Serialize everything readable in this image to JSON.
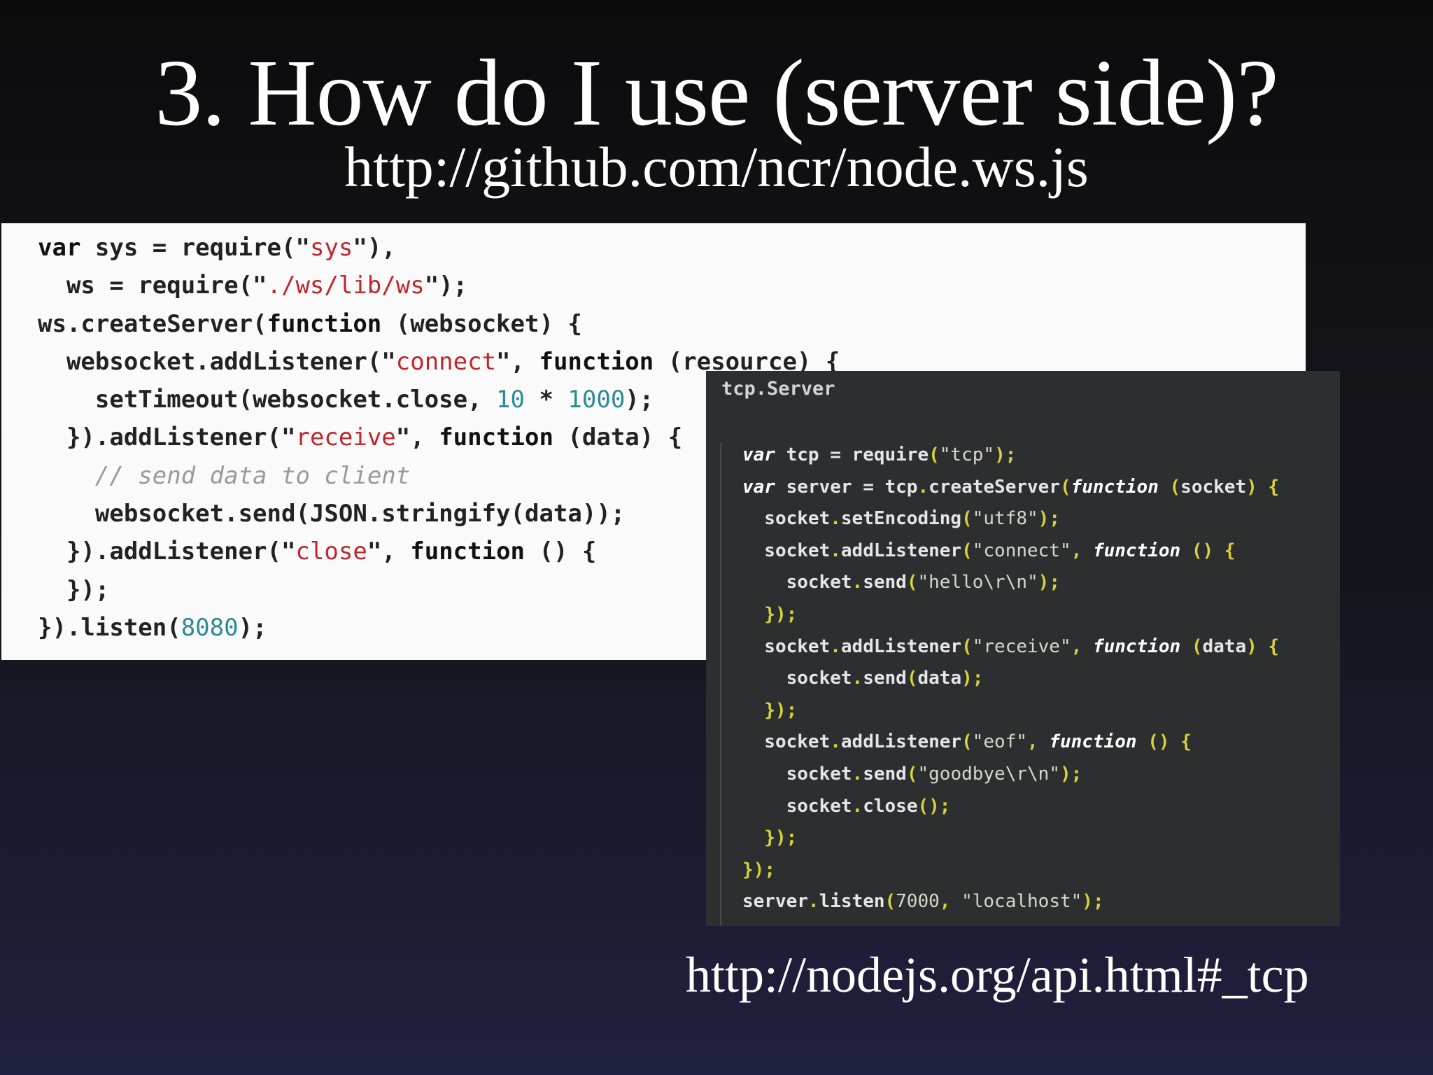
{
  "slide": {
    "title": "3. How do I use (server side)?",
    "subtitle": "http://github.com/ncr/node.ws.js",
    "footer_link": "http://nodejs.org/api.html#_tcp"
  },
  "websocket_snippet": {
    "lines": [
      "var sys = require(\"sys\"),",
      "  ws = require(\"./ws/lib/ws\");",
      "ws.createServer(function (websocket) {",
      "  websocket.addListener(\"connect\", function (resource) {",
      "    setTimeout(websocket.close, 10 * 1000);",
      "  }).addListener(\"receive\", function (data) {",
      "    // send data to client",
      "    websocket.send(JSON.stringify(data));",
      "  }).addListener(\"close\", function () {",
      "  });",
      "}).listen(8080);"
    ],
    "colors": {
      "background": "#fafafa",
      "text": "#222222",
      "keyword": "#111111",
      "string": "#c0262e",
      "number": "#2a8a96",
      "comment": "#9a9a9a"
    }
  },
  "tcp_snippet": {
    "header": "tcp.Server",
    "lines": [
      "var tcp = require(\"tcp\");",
      "var server = tcp.createServer(function (socket) {",
      "  socket.setEncoding(\"utf8\");",
      "  socket.addListener(\"connect\", function () {",
      "    socket.send(\"hello\\r\\n\");",
      "  });",
      "  socket.addListener(\"receive\", function (data) {",
      "    socket.send(data);",
      "  });",
      "  socket.addListener(\"eof\", function () {",
      "    socket.send(\"goodbye\\r\\n\");",
      "    socket.close();",
      "  });",
      "});",
      "server.listen(7000, \"localhost\");"
    ],
    "colors": {
      "background": "#2c2e30",
      "text": "#e6e6e6",
      "keyword": "#ffffff",
      "string": "#d8d8c8",
      "punctuation": "#d8d33a"
    }
  }
}
